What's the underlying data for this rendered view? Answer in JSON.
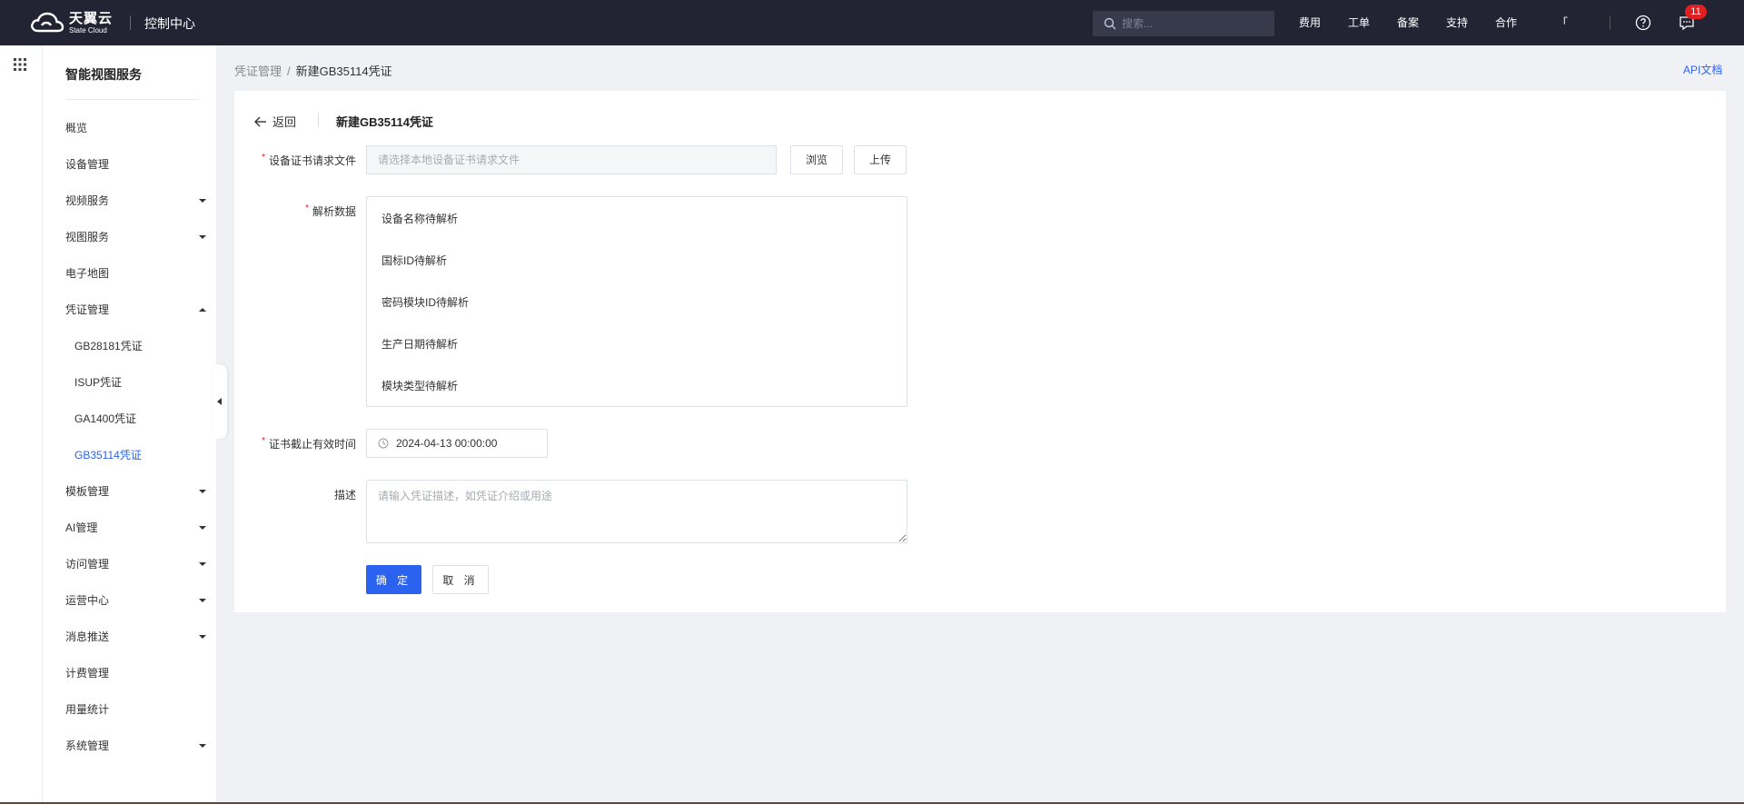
{
  "header": {
    "logo_cn": "天翼云",
    "logo_en": "State Cloud",
    "console_title": "控制中心",
    "search_placeholder": "搜索...",
    "nav": [
      "费用",
      "工单",
      "备案",
      "支持",
      "合作"
    ],
    "user_label": "「",
    "notification_count": "11"
  },
  "sidebar": {
    "title": "智能视图服务",
    "items": [
      {
        "label": "概览"
      },
      {
        "label": "设备管理"
      },
      {
        "label": "视频服务"
      },
      {
        "label": "视图服务"
      },
      {
        "label": "电子地图"
      },
      {
        "label": "凭证管理"
      },
      {
        "label": "GB28181凭证"
      },
      {
        "label": "ISUP凭证"
      },
      {
        "label": "GA1400凭证"
      },
      {
        "label": "GB35114凭证"
      },
      {
        "label": "模板管理"
      },
      {
        "label": "AI管理"
      },
      {
        "label": "访问管理"
      },
      {
        "label": "运营中心"
      },
      {
        "label": "消息推送"
      },
      {
        "label": "计费管理"
      },
      {
        "label": "用量统计"
      },
      {
        "label": "系统管理"
      }
    ]
  },
  "breadcrumb": {
    "parent": "凭证管理",
    "separator": "/",
    "current": "新建GB35114凭证"
  },
  "api_doc": "API文档",
  "page": {
    "back": "返回",
    "title": "新建GB35114凭证"
  },
  "form": {
    "required_mark": "*",
    "cert_file": {
      "label": "设备证书请求文件",
      "placeholder": "请选择本地设备证书请求文件",
      "browse": "浏览",
      "upload": "上传"
    },
    "parse": {
      "label": "解析数据",
      "items": [
        "设备名称待解析",
        "国标ID待解析",
        "密码模块ID待解析",
        "生产日期待解析",
        "模块类型待解析"
      ]
    },
    "expiry": {
      "label": "证书截止有效时间",
      "value": "2024-04-13 00:00:00"
    },
    "description": {
      "label": "描述",
      "placeholder": "请输入凭证描述，如凭证介绍或用途"
    },
    "confirm": "确 定",
    "cancel": "取 消"
  },
  "colors": {
    "accent": "#2b62f0",
    "topbar": "#222433",
    "badge": "#e02020",
    "required": "#e02020"
  }
}
